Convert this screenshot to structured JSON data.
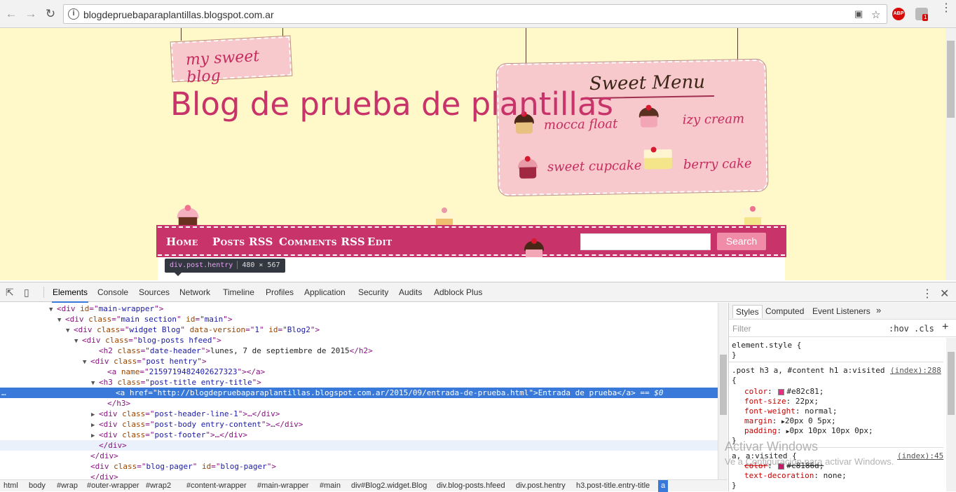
{
  "browser": {
    "url": "blogdepruebaparaplantillas.blogspot.com.ar",
    "ext_abp": "ABP",
    "ext_badge": "1"
  },
  "page": {
    "tag_text": "my sweet blog",
    "blog_title": "Blog de prueba de plantillas",
    "menu_title": "Sweet Menu",
    "menu_items": [
      "mocca float",
      "izy cream",
      "sweet cupcake",
      "berry cake"
    ],
    "nav": [
      "Home",
      "Posts RSS",
      "Comments RSS",
      "Edit"
    ],
    "search_button": "Search"
  },
  "tooltip": {
    "element": "div",
    "classes": ".post.hentry",
    "dims": "480 × 567"
  },
  "devtools": {
    "tabs": [
      "Elements",
      "Console",
      "Sources",
      "Network",
      "Timeline",
      "Profiles",
      "Application",
      "Security",
      "Audits",
      "Adblock Plus"
    ],
    "dom": [
      {
        "tri": "▼",
        "indent": 6,
        "parts": [
          [
            "t",
            "<div "
          ],
          [
            "an",
            "id"
          ],
          [
            "t",
            "=\""
          ],
          [
            "av",
            "main-wrapper"
          ],
          [
            "t",
            "\">"
          ]
        ]
      },
      {
        "tri": "▼",
        "indent": 7,
        "parts": [
          [
            "t",
            "<div "
          ],
          [
            "an",
            "class"
          ],
          [
            "t",
            "=\""
          ],
          [
            "av",
            "main section"
          ],
          [
            "t",
            "\" "
          ],
          [
            "an",
            "id"
          ],
          [
            "t",
            "=\""
          ],
          [
            "av",
            "main"
          ],
          [
            "t",
            "\">"
          ]
        ]
      },
      {
        "tri": "▼",
        "indent": 8,
        "parts": [
          [
            "t",
            "<div "
          ],
          [
            "an",
            "class"
          ],
          [
            "t",
            "=\""
          ],
          [
            "av",
            "widget Blog"
          ],
          [
            "t",
            "\" "
          ],
          [
            "an",
            "data-version"
          ],
          [
            "t",
            "=\""
          ],
          [
            "av",
            "1"
          ],
          [
            "t",
            "\" "
          ],
          [
            "an",
            "id"
          ],
          [
            "t",
            "=\""
          ],
          [
            "av",
            "Blog2"
          ],
          [
            "t",
            "\">"
          ]
        ]
      },
      {
        "tri": "▼",
        "indent": 9,
        "parts": [
          [
            "t",
            "<div "
          ],
          [
            "an",
            "class"
          ],
          [
            "t",
            "=\""
          ],
          [
            "av",
            "blog-posts hfeed"
          ],
          [
            "t",
            "\">"
          ]
        ]
      },
      {
        "tri": "",
        "indent": 11,
        "parts": [
          [
            "t",
            "<h2 "
          ],
          [
            "an",
            "class"
          ],
          [
            "t",
            "=\""
          ],
          [
            "av",
            "date-header"
          ],
          [
            "t",
            "\">"
          ],
          [
            "tx",
            "lunes, 7 de septiembre de 2015"
          ],
          [
            "t",
            "</h2>"
          ]
        ]
      },
      {
        "tri": "▼",
        "indent": 10,
        "parts": [
          [
            "t",
            "<div "
          ],
          [
            "an",
            "class"
          ],
          [
            "t",
            "=\""
          ],
          [
            "av",
            "post hentry"
          ],
          [
            "t",
            "\">"
          ]
        ]
      },
      {
        "tri": "",
        "indent": 12,
        "parts": [
          [
            "t",
            "<a "
          ],
          [
            "an",
            "name"
          ],
          [
            "t",
            "=\""
          ],
          [
            "av",
            "2159719482402627323"
          ],
          [
            "t",
            "\"></a>"
          ]
        ]
      },
      {
        "tri": "▼",
        "indent": 11,
        "parts": [
          [
            "t",
            "<h3 "
          ],
          [
            "an",
            "class"
          ],
          [
            "t",
            "=\""
          ],
          [
            "av",
            "post-title entry-title"
          ],
          [
            "t",
            "\">"
          ]
        ]
      },
      {
        "tri": "",
        "indent": 13,
        "sel": true,
        "parts": [
          [
            "t",
            "<a "
          ],
          [
            "an",
            "href"
          ],
          [
            "t",
            "=\""
          ],
          [
            "av",
            "http://blogdepruebaparaplantillas.blogspot.com.ar/2015/09/entrada-de-prueba.html"
          ],
          [
            "t",
            "\">"
          ],
          [
            "tx",
            "Entrada de prueba"
          ],
          [
            "t",
            "</a>"
          ],
          [
            "eq",
            " == $0"
          ]
        ]
      },
      {
        "tri": "",
        "indent": 12,
        "parts": [
          [
            "t",
            "</h3>"
          ]
        ]
      },
      {
        "tri": "▶",
        "indent": 11,
        "parts": [
          [
            "t",
            "<div "
          ],
          [
            "an",
            "class"
          ],
          [
            "t",
            "=\""
          ],
          [
            "av",
            "post-header-line-1"
          ],
          [
            "t",
            "\">…</div>"
          ]
        ]
      },
      {
        "tri": "▶",
        "indent": 11,
        "parts": [
          [
            "t",
            "<div "
          ],
          [
            "an",
            "class"
          ],
          [
            "t",
            "=\""
          ],
          [
            "av",
            "post-body entry-content"
          ],
          [
            "t",
            "\">…</div>"
          ]
        ]
      },
      {
        "tri": "▶",
        "indent": 11,
        "parts": [
          [
            "t",
            "<div "
          ],
          [
            "an",
            "class"
          ],
          [
            "t",
            "=\""
          ],
          [
            "av",
            "post-footer"
          ],
          [
            "t",
            "\">…</div>"
          ]
        ]
      },
      {
        "tri": "",
        "indent": 11,
        "hover": true,
        "parts": [
          [
            "t",
            "</div>"
          ]
        ]
      },
      {
        "tri": "",
        "indent": 10,
        "parts": [
          [
            "t",
            "</div>"
          ]
        ]
      },
      {
        "tri": "",
        "indent": 10,
        "parts": [
          [
            "t",
            "<div "
          ],
          [
            "an",
            "class"
          ],
          [
            "t",
            "=\""
          ],
          [
            "av",
            "blog-pager"
          ],
          [
            "t",
            "\" "
          ],
          [
            "an",
            "id"
          ],
          [
            "t",
            "=\""
          ],
          [
            "av",
            "blog-pager"
          ],
          [
            "t",
            "\">"
          ]
        ]
      },
      {
        "tri": "",
        "indent": 10,
        "parts": [
          [
            "t",
            "</div>"
          ]
        ]
      }
    ],
    "breadcrumbs": [
      "html",
      "body",
      "#wrap",
      "#outer-wrapper",
      "#wrap2",
      "#content-wrapper",
      "#main-wrapper",
      "#main",
      "div#Blog2.widget.Blog",
      "div.blog-posts.hfeed",
      "div.post.hentry",
      "h3.post-title.entry-title",
      "a"
    ],
    "styles_tabs": [
      "Styles",
      "Computed",
      "Event Listeners"
    ],
    "filter_placeholder": "Filter",
    "hov": ":hov",
    "cls": ".cls",
    "rules": {
      "element_style": "element.style {",
      "close": "}",
      "selector2": ".post h3 a, #content h1 a:visited",
      "src2": "(index):288",
      "open": "{",
      "decls2": [
        {
          "p": "color",
          "v": "#e82c81;",
          "swatch": "#e82c81"
        },
        {
          "p": "font-size",
          "v": "22px;"
        },
        {
          "p": "font-weight",
          "v": "normal;"
        },
        {
          "p": "margin",
          "v": "20px 0 5px;",
          "arrow": true
        },
        {
          "p": "padding",
          "v": "0px 10px 10px 0px;",
          "arrow": true
        }
      ],
      "selector3": "a, a:visited {",
      "src3": "(index):45",
      "decls3": [
        {
          "p": "color",
          "v": "#c8186d;",
          "swatch": "#c8186d",
          "strike": true
        },
        {
          "p": "text-decoration",
          "v": "none;"
        }
      ]
    },
    "watermark": "Activar Windows",
    "watermark_sub": "Ve a Configuración para activar Windows."
  }
}
